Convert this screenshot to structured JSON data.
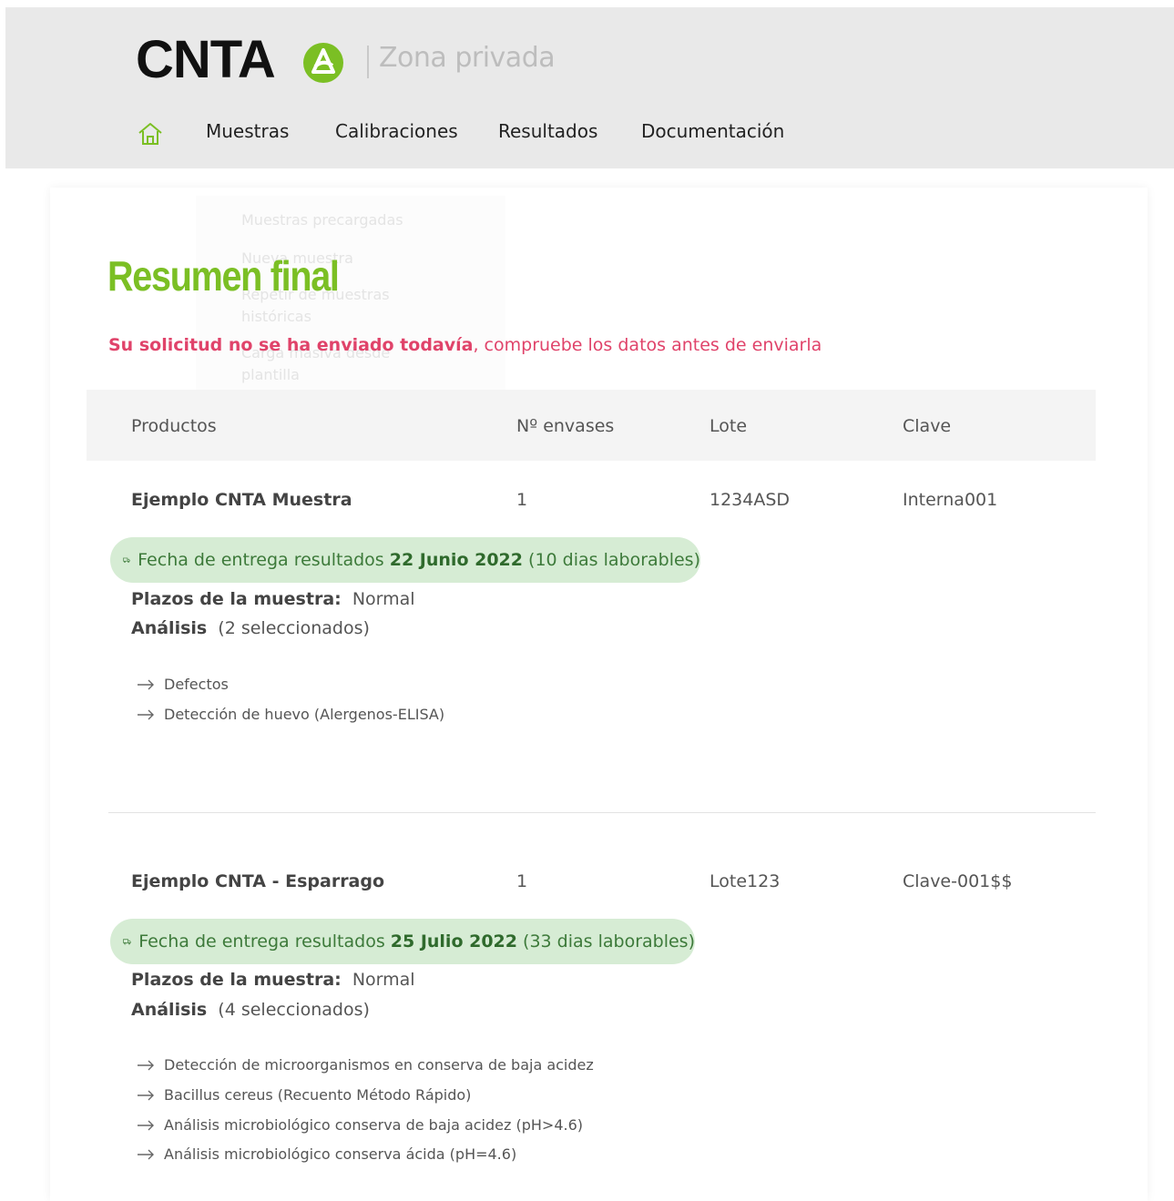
{
  "header": {
    "logo_text": "CNTA",
    "zone_label": "Zona privada",
    "colors": {
      "brand_green": "#7bbf24",
      "header_bg": "#e9e9e9"
    },
    "nav": {
      "home_icon": "home-icon",
      "items": [
        "Muestras",
        "Calibraciones",
        "Resultados",
        "Documentación"
      ]
    }
  },
  "ghost_menu": {
    "items": [
      "Muestras precargadas",
      "Nueva muestra",
      "Repetir de muestras",
      "históricas",
      "Carga masiva desde",
      "plantilla"
    ]
  },
  "page": {
    "title": "Resumen final",
    "warning_bold": "Su solicitud no se ha enviado todavía",
    "warning_rest": ", compruebe los datos antes de enviarla",
    "warning_color": "#e0436a"
  },
  "table": {
    "headers": [
      "Productos",
      "Nº envases",
      "Lote",
      "Clave"
    ]
  },
  "samples": [
    {
      "product": "Ejemplo CNTA Muestra",
      "envases": "1",
      "lote": "1234ASD",
      "clave": "Interna001",
      "delivery_prefix": "Fecha de entrega resultados ",
      "delivery_date": "22 Junio 2022",
      "delivery_days": " (10 dias laborables)",
      "plazos_label": "Plazos de la muestra:",
      "plazos_value": " Normal",
      "analysis_label": "Análisis",
      "analysis_count": " (2 seleccionados)",
      "analyses": [
        "Defectos",
        "Detección de huevo (Alergenos-ELISA)"
      ]
    },
    {
      "product": "Ejemplo CNTA - Esparrago",
      "envases": "1",
      "lote": "Lote123",
      "clave": "Clave-001$$",
      "delivery_prefix": "Fecha de entrega resultados ",
      "delivery_date": "25 Julio 2022",
      "delivery_days": " (33 dias laborables)",
      "plazos_label": "Plazos de la muestra:",
      "plazos_value": " Normal",
      "analysis_label": "Análisis",
      "analysis_count": " (4 seleccionados)",
      "analyses": [
        "Detección de microorganismos en conserva de baja acidez",
        "Bacillus cereus (Recuento Método Rápido)",
        "Análisis microbiológico conserva de baja acidez (pH>4.6)",
        "Análisis microbiológico conserva ácida (pH=4.6)"
      ]
    }
  ]
}
